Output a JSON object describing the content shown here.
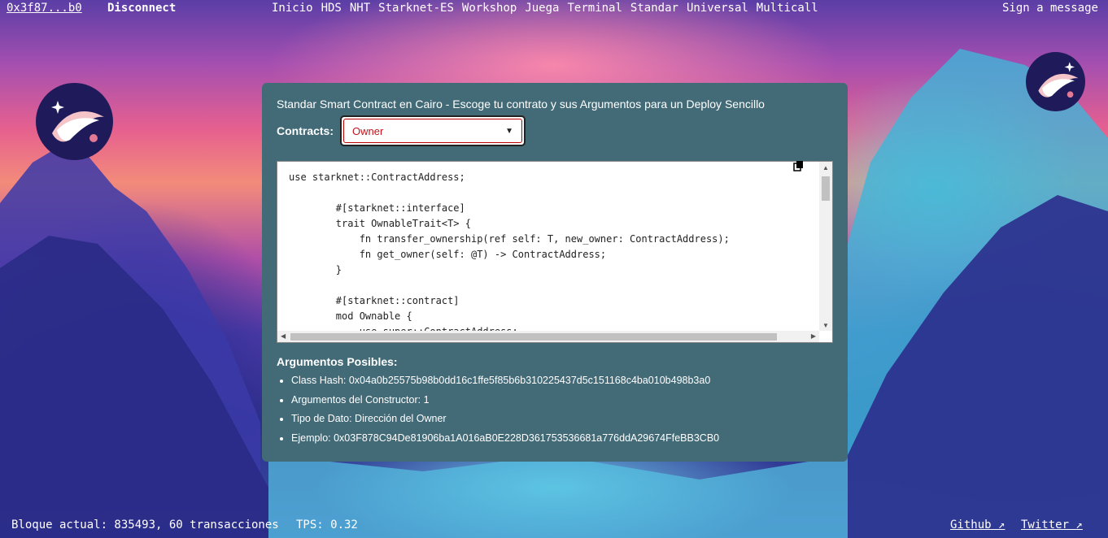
{
  "header": {
    "address": "0x3f87...b0",
    "disconnect_label": "Disconnect",
    "nav": [
      "Inicio",
      "HDS",
      "NHT",
      "Starknet-ES",
      "Workshop",
      "Juega",
      "Terminal",
      "Standar",
      "Universal",
      "Multicall"
    ],
    "sign_message_label": "Sign a message"
  },
  "panel": {
    "title": "Standar Smart Contract en Cairo - Escoge tu contrato y sus Argumentos para un Deploy Sencillo",
    "contracts_label": "Contracts:",
    "selected_contract": "Owner",
    "code": "use starknet::ContractAddress;\n\n        #[starknet::interface]\n        trait OwnableTrait<T> {\n            fn transfer_ownership(ref self: T, new_owner: ContractAddress);\n            fn get_owner(self: @T) -> ContractAddress;\n        }\n\n        #[starknet::contract]\n        mod Ownable {\n            use super::ContractAddress;",
    "args_title": "Argumentos Posibles:",
    "args": [
      "Class Hash: 0x04a0b25575b98b0dd16c1ffe5f85b6b310225437d5c151168c4ba010b498b3a0",
      "Argumentos del Constructor: 1",
      "Tipo de Dato: Dirección del Owner",
      "Ejemplo: 0x03F878C94De81906ba1A016aB0E228D361753536681a776ddA29674FfeBB3CB0"
    ]
  },
  "footer": {
    "block_info": "Bloque actual: 835493, 60 transacciones",
    "tps": "TPS: 0.32",
    "github": "Github ↗",
    "twitter": "Twitter ↗"
  },
  "colors": {
    "panel": "#426a77",
    "select_text": "#c0141b"
  }
}
